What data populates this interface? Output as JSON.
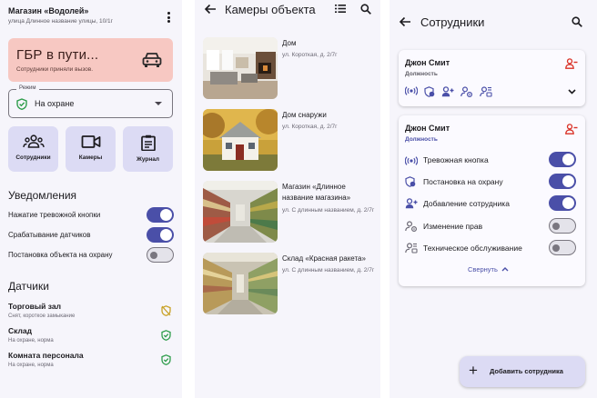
{
  "colors": {
    "primary": "#4a4fa8",
    "alarm_bg": "#f7c8c2",
    "tile_bg": "#dcdbf4",
    "ok_green": "#2e9d4b",
    "warn_yellow": "#c9a227",
    "danger_red": "#d93025"
  },
  "screen1": {
    "store_title": "Магазин «Водолей»",
    "store_address": "улица Длинное название улицы, 10/1г",
    "alarm": {
      "title": "ГБР в пути...",
      "subtitle": "Сотрудники приняли вызов.",
      "icon": "car-icon"
    },
    "mode": {
      "label": "Режим",
      "value": "На охране",
      "icon": "shield-check-icon"
    },
    "quick_actions": [
      {
        "label": "Сотрудники",
        "icon": "people-icon"
      },
      {
        "label": "Камеры",
        "icon": "videocam-icon"
      },
      {
        "label": "Журнал",
        "icon": "clipboard-icon"
      }
    ],
    "notifications": {
      "title": "Уведомления",
      "items": [
        {
          "label": "Нажатие тревожной кнопки",
          "on": true
        },
        {
          "label": "Срабатывание датчиков",
          "on": true
        },
        {
          "label": "Постановка объекта на охрану",
          "on": false
        }
      ]
    },
    "sensors": {
      "title": "Датчики",
      "items": [
        {
          "name": "Торговый зал",
          "state": "Снят, короткое замыкание",
          "icon": "shield-off-icon"
        },
        {
          "name": "Склад",
          "state": "На охране, норма",
          "icon": "shield-check-icon"
        },
        {
          "name": "Комната персонала",
          "state": "На охране, норма",
          "icon": "shield-check-icon"
        }
      ]
    }
  },
  "screen2": {
    "title": "Камеры объекта",
    "cameras": [
      {
        "name": "Дом",
        "address": "ул. Короткая, д. 2/7г"
      },
      {
        "name": "Дом снаружи",
        "address": "ул. Короткая, д. 2/7г"
      },
      {
        "name": "Магазин «Длинное название магазина»",
        "address": "ул. С длинным названием, д. 2/7г"
      },
      {
        "name": "Склад «Красная ракета»",
        "address": "ул. С длинным названием, д. 2/7г"
      }
    ]
  },
  "screen3": {
    "title": "Сотрудники",
    "employees": [
      {
        "name": "Джон Смит",
        "role": "Должность",
        "expanded": false
      },
      {
        "name": "Джон Смит",
        "role": "Должность",
        "expanded": true,
        "permissions": [
          {
            "label": "Тревожная кнопка",
            "on": true,
            "icon": "alarm-signal-icon"
          },
          {
            "label": "Постановка на охрану",
            "on": true,
            "icon": "shield-clock-icon"
          },
          {
            "label": "Добавление сотрудника",
            "on": true,
            "icon": "person-add-icon"
          },
          {
            "label": "Изменение прав",
            "on": false,
            "icon": "person-gear-icon"
          },
          {
            "label": "Техническое обслуживание",
            "on": false,
            "icon": "manage-accounts-icon"
          }
        ],
        "collapse_label": "Свернуть"
      }
    ],
    "fab_label": "Добавить сотрудника"
  }
}
